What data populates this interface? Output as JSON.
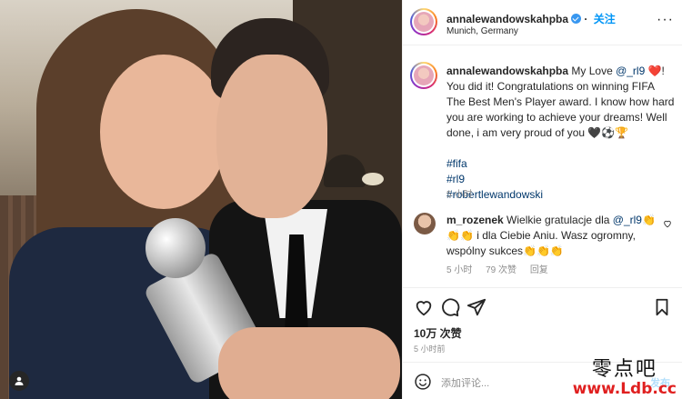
{
  "post": {
    "username": "annalewandowskahpba",
    "follow_label": "关注",
    "location": "Munich, Germany",
    "more_icon": "more-horizontal-icon"
  },
  "caption": {
    "username": "annalewandowskahpba",
    "body_start": "My Love ",
    "mention": "@_rl9",
    "body_end": " ❤️! You did it! Congratulations on winning FIFA The Best Men's Player award. I know how hard you are working to achieve your dreams! Well done, i am very proud of you 🖤⚽🏆",
    "hashtags": [
      "#fifa",
      "#rl9",
      "#robertlewandowski"
    ],
    "time": "5 小时"
  },
  "comment": {
    "username": "m_rozenek",
    "text_start": " Wielkie gratulacje dla ",
    "mention": "@_rl9",
    "text_end": "👏👏👏 i dla Ciebie Aniu. Wasz ogromny, wspólny sukces👏👏👏",
    "time": "5 小时",
    "likes": "79 次赞",
    "reply": "回复"
  },
  "stats": {
    "likes": "10万 次赞",
    "posted": "5 小时前"
  },
  "add_comment": {
    "placeholder": "添加评论...",
    "post_label": "发布"
  },
  "watermark": {
    "cn": "零点吧",
    "url": "www.Ldb.cc"
  },
  "colors": {
    "link_blue": "#0095f6",
    "tag_blue": "#00376b",
    "muted": "#8e8e8e",
    "watermark_red": "#e02020"
  }
}
